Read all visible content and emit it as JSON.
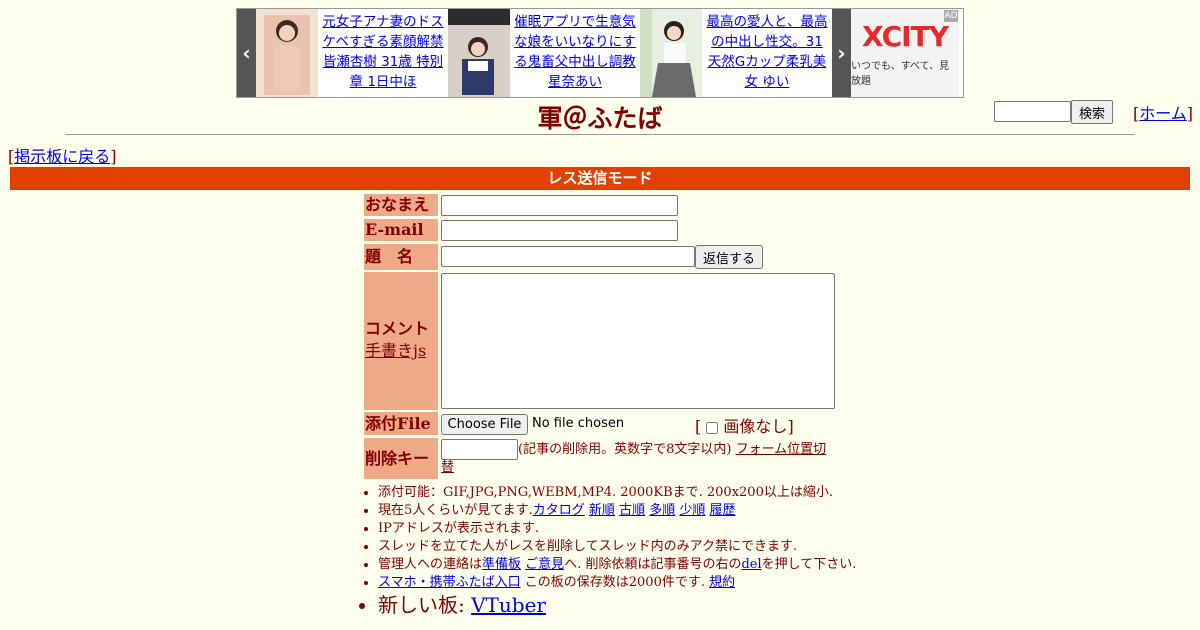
{
  "ad": {
    "prev_label": "‹",
    "next_label": "›",
    "items": [
      {
        "text": "元女子アナ妻のドスケベすぎる素顔解禁 皆瀬杏樹 31歳 特別章 1日中ほ"
      },
      {
        "text": "催眠アプリで生意気な娘をいいなりにする鬼畜父中出し調教 星奈あい"
      },
      {
        "text": "最高の愛人と、最高の中出し性交。31 天然Gカップ柔乳美女 ゆい"
      }
    ],
    "sponsor": {
      "logo": "XCITY",
      "tagline": "いつでも、すべて、見放題"
    },
    "badge": "AD"
  },
  "header": {
    "title": "軍＠ふたば",
    "search_button": "検索",
    "home_link": "ホーム"
  },
  "nav": {
    "back_link": "掲示板に戻る"
  },
  "mode_bar": "レス送信モード",
  "form": {
    "name_label": "おなまえ",
    "email_label": "E-mail",
    "subject_label": "題　名",
    "submit_button": "返信する",
    "comment_label": "コメント",
    "handwriting_link": "手書きjs",
    "file_label": "添付File",
    "choose_file_button": "Choose File",
    "no_file_text": "No file chosen",
    "no_image_label": "画像なし",
    "delete_key_label": "削除キー",
    "delete_key_hint": "(記事の削除用。英数字で8文字以内)",
    "form_position_link": "フォーム位置切替"
  },
  "rules": {
    "item1": "添付可能：GIF,JPG,PNG,WEBM,MP4. 2000KBまで. 200x200以上は縮小.",
    "item2_prefix": "現在5人くらいが見てます.",
    "item2_links": [
      "カタログ",
      "新順",
      "古順",
      "多順",
      "少順",
      "履歴"
    ],
    "item3": "IPアドレスが表示されます.",
    "item4": "スレッドを立てた人がレスを削除してスレッド内のみアク禁にできます.",
    "item5_prefix": "管理人への連絡は",
    "item5_link1": "準備板",
    "item5_link2": "ご意見",
    "item5_mid": "へ. 削除依頼は記事番号の右の",
    "item5_del": "del",
    "item5_suffix": "を押して下さい.",
    "item6_link": "スマホ・携帯ふたば入口",
    "item6_suffix": " この板の保存数は2000件です.",
    "item6_link2": "規約",
    "new_board_prefix": "新しい板: ",
    "new_board_link": "VTuber"
  }
}
